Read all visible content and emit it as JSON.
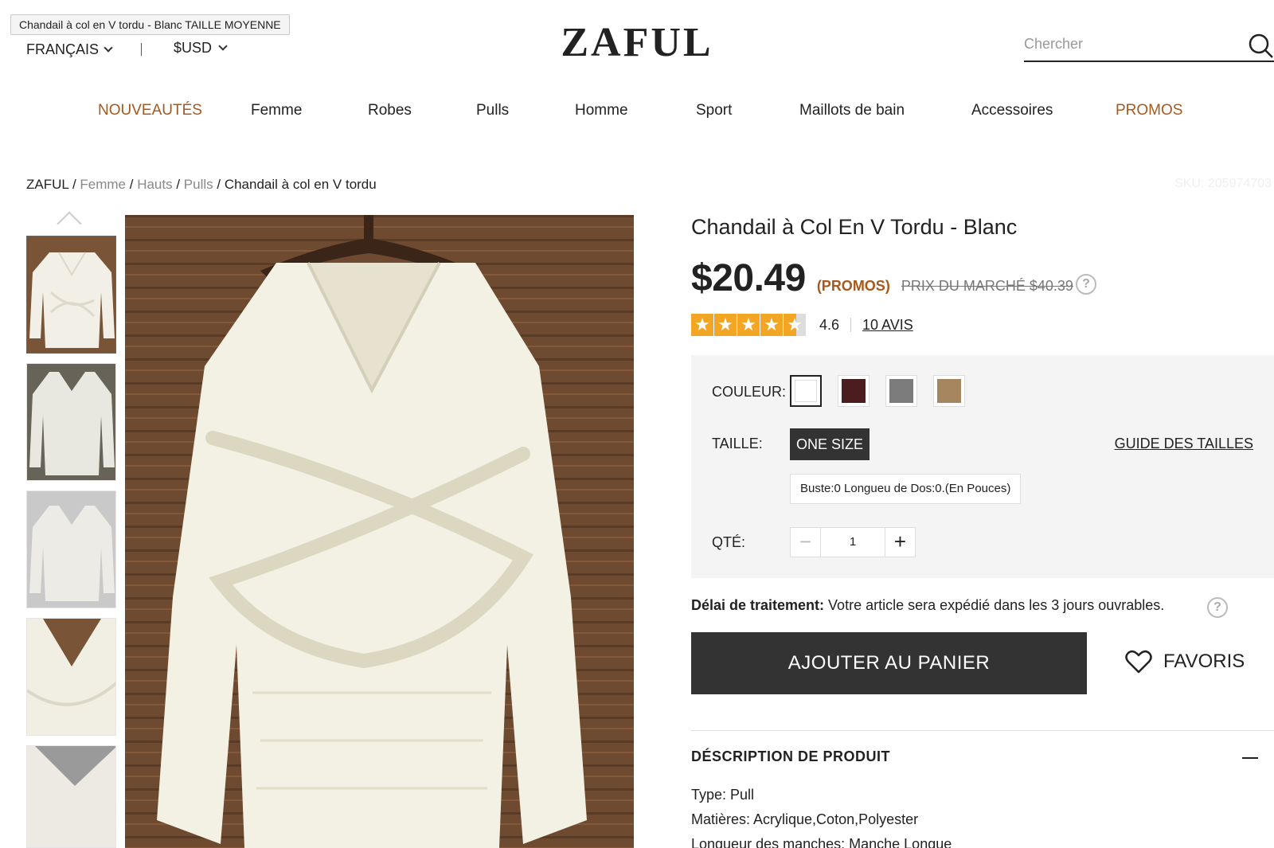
{
  "tooltip": "Chandail à col en V tordu - Blanc TAILLE MOYENNE",
  "header": {
    "language": "FRANÇAIS",
    "currency": "$USD",
    "logo": "ZAFUL",
    "search_placeholder": "Chercher"
  },
  "nav": {
    "items": [
      {
        "label": "NOUVEAUTÉS"
      },
      {
        "label": "Femme"
      },
      {
        "label": "Robes"
      },
      {
        "label": "Pulls"
      },
      {
        "label": "Homme"
      },
      {
        "label": "Sport"
      },
      {
        "label": "Maillots de bain"
      },
      {
        "label": "Accessoires"
      },
      {
        "label": "PROMOS"
      }
    ],
    "accent_color": "#a8581c"
  },
  "breadcrumb": {
    "items": [
      "ZAFUL",
      "Femme",
      "Hauts",
      "Pulls"
    ],
    "separator": " / ",
    "current": "Chandail à col en V tordu"
  },
  "sku": "SKU: 205974703",
  "product": {
    "title": "Chandail à Col En V Tordu - Blanc",
    "price": "$20.49",
    "promo_label": "(PROMOS)",
    "market_price": "PRIX DU MARCHÉ $40.39",
    "help_icon": "?",
    "rating": "4.6",
    "rating_stars": 4.6,
    "reviews": "10 AVIS",
    "star_color": "#f2a623"
  },
  "options": {
    "color_label": "COULEUR:",
    "colors": [
      "#ffffff",
      "#4a1e1e",
      "#7c7c7c",
      "#a6865e"
    ],
    "size_label": "TAILLE:",
    "size_value": "ONE SIZE",
    "size_guide": "GUIDE DES TAILLES",
    "measurements": "Buste:0   Longueu de Dos:0.(En Pouces)",
    "qty_label": "QTÉ:",
    "qty_value": "1",
    "qty_minus": "−",
    "qty_plus": "+"
  },
  "processing": {
    "label": "Délai de traitement:",
    "text": " Votre article sera expédié dans les 3 jours ouvrables."
  },
  "actions": {
    "add_to_cart": "AJOUTER AU PANIER",
    "favorites": "FAVORIS"
  },
  "description": {
    "title": "DÉSCRIPTION DE PRODUIT",
    "lines": [
      "Type: Pull",
      "Matières: Acrylique,Coton,Polyester",
      "Longueur des manches: Manche Longue"
    ]
  }
}
